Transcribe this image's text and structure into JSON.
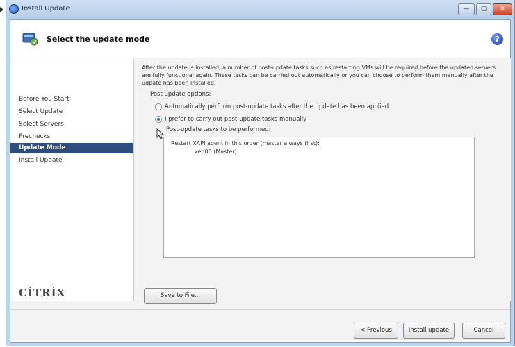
{
  "window": {
    "title": "Install Update"
  },
  "window_controls": {
    "minimize": "—",
    "maximize": "▢",
    "close": "✕"
  },
  "header": {
    "title": "Select the update mode",
    "help": "?"
  },
  "sidebar": {
    "items": [
      {
        "label": "Before You Start",
        "active": false
      },
      {
        "label": "Select Update",
        "active": false
      },
      {
        "label": "Select Servers",
        "active": false
      },
      {
        "label": "Prechecks",
        "active": false
      },
      {
        "label": "Update Mode",
        "active": true
      },
      {
        "label": "Install Update",
        "active": false
      }
    ],
    "logo": "CİTRİX"
  },
  "main": {
    "description": "After the update is installed, a number of post-update tasks such as restarting VMs will be required before the updated servers are fully functional again. These tasks can be carried out automatically or you can choose to perform them manually after the udpate has been installed.",
    "options_label": "Post update options:",
    "options": [
      {
        "label": "Automatically perform post-update tasks after the update has been applied",
        "selected": false
      },
      {
        "label": "I prefer to carry out post-update tasks manually",
        "selected": true
      }
    ],
    "tasks_label": "Post-update tasks to be performed:",
    "tasks": [
      "Restart XAPI agent in this order (master always first):",
      "xen00 (Master)"
    ],
    "save_button": "Save to File..."
  },
  "footer": {
    "previous_button": "< Previous",
    "install_button": "Install update",
    "cancel_button": "Cancel"
  }
}
